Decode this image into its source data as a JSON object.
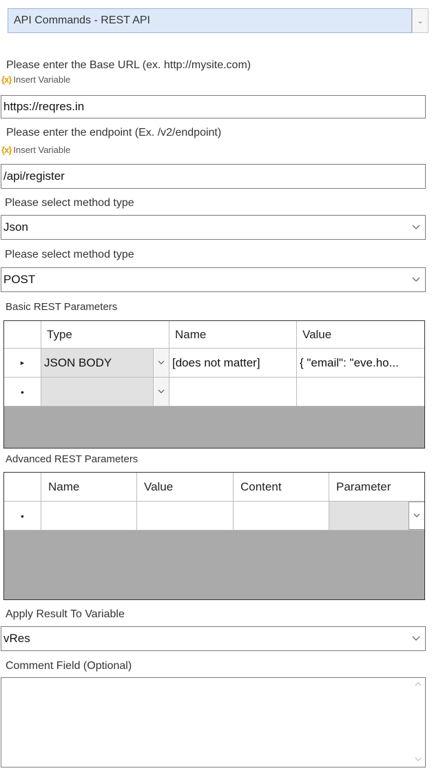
{
  "command": {
    "selected": "API Commands - REST API"
  },
  "base_url": {
    "label": "Please enter the Base URL (ex. http://mysite.com)",
    "insert_variable": "Insert Variable",
    "value": "https://reqres.in"
  },
  "endpoint": {
    "label": "Please enter the endpoint (Ex. /v2/endpoint)",
    "insert_variable": "Insert Variable",
    "value": "/api/register"
  },
  "request_format": {
    "label": "Please select method type",
    "value": "Json"
  },
  "method": {
    "label": "Please select method type",
    "value": "POST"
  },
  "basic_params": {
    "label": "Basic REST Parameters",
    "columns": [
      "Type",
      "Name",
      "Value"
    ],
    "rows": [
      {
        "marker": "▸",
        "type": "JSON BODY",
        "name": "[does not matter]",
        "value": "{ \"email\": \"eve.ho..."
      },
      {
        "marker": "•",
        "type": "",
        "name": "",
        "value": ""
      }
    ]
  },
  "advanced_params": {
    "label": "Advanced REST Parameters",
    "columns": [
      "Name",
      "Value",
      "Content",
      "Parameter"
    ],
    "rows": [
      {
        "marker": "•",
        "name": "",
        "value": "",
        "content": "",
        "parameter": ""
      }
    ]
  },
  "result_variable": {
    "label": "Apply Result To Variable",
    "value": "vRes"
  },
  "comment": {
    "label": "Comment Field (Optional)",
    "value": ""
  },
  "icons": {
    "variable": "{x}",
    "dropdown": "chevron-down-icon"
  }
}
